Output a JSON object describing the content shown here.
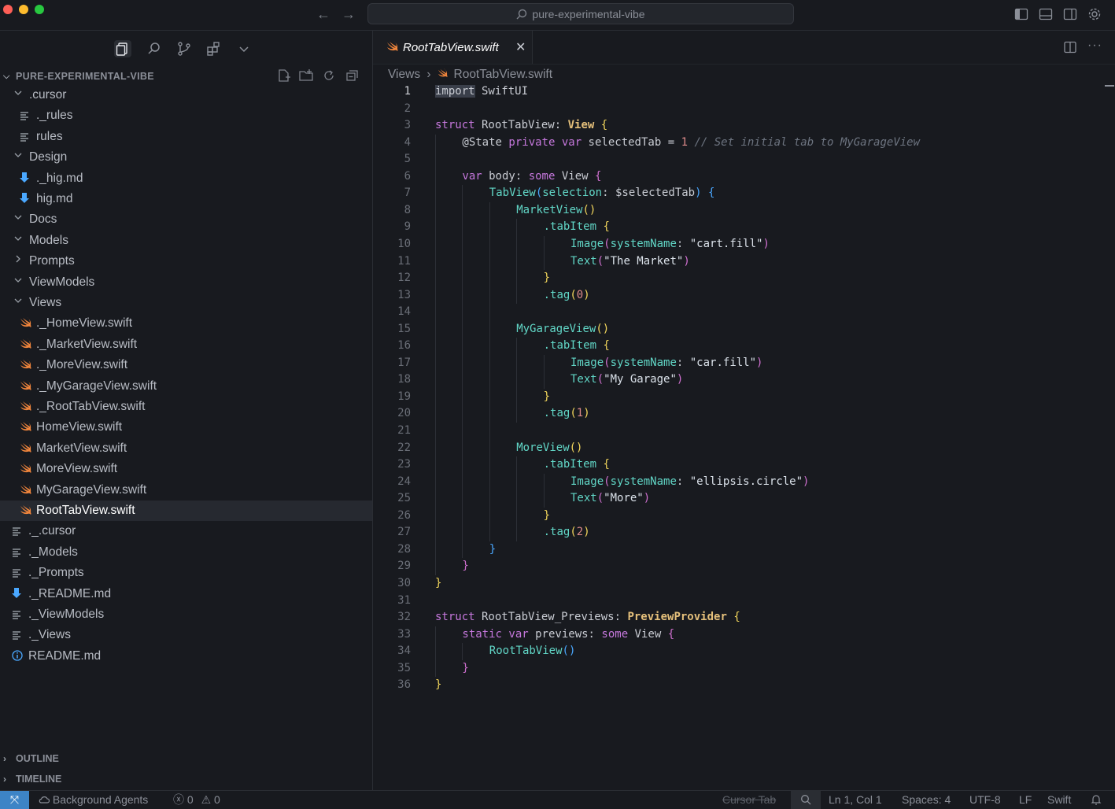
{
  "window": {
    "command_center_text": "pure-experimental-vibe",
    "back_label": "←",
    "forward_label": "→"
  },
  "explorer": {
    "root_label": "PURE-EXPERIMENTAL-VIBE",
    "tree": [
      {
        "label": ".cursor",
        "kind": "folder",
        "expanded": true,
        "depth": 0
      },
      {
        "label": "._rules",
        "kind": "file-lines",
        "depth": 1
      },
      {
        "label": "rules",
        "kind": "file-lines",
        "depth": 1
      },
      {
        "label": "Design",
        "kind": "folder",
        "expanded": true,
        "depth": 0
      },
      {
        "label": "._hig.md",
        "kind": "markdown",
        "depth": 1
      },
      {
        "label": "hig.md",
        "kind": "markdown",
        "depth": 1
      },
      {
        "label": "Docs",
        "kind": "folder",
        "expanded": true,
        "depth": 0
      },
      {
        "label": "Models",
        "kind": "folder",
        "expanded": true,
        "depth": 0
      },
      {
        "label": "Prompts",
        "kind": "folder",
        "expanded": false,
        "depth": 0
      },
      {
        "label": "ViewModels",
        "kind": "folder",
        "expanded": true,
        "depth": 0
      },
      {
        "label": "Views",
        "kind": "folder",
        "expanded": true,
        "depth": 0
      },
      {
        "label": "._HomeView.swift",
        "kind": "swift",
        "depth": 1
      },
      {
        "label": "._MarketView.swift",
        "kind": "swift",
        "depth": 1
      },
      {
        "label": "._MoreView.swift",
        "kind": "swift",
        "depth": 1
      },
      {
        "label": "._MyGarageView.swift",
        "kind": "swift",
        "depth": 1
      },
      {
        "label": "._RootTabView.swift",
        "kind": "swift",
        "depth": 1
      },
      {
        "label": "HomeView.swift",
        "kind": "swift",
        "depth": 1
      },
      {
        "label": "MarketView.swift",
        "kind": "swift",
        "depth": 1
      },
      {
        "label": "MoreView.swift",
        "kind": "swift",
        "depth": 1
      },
      {
        "label": "MyGarageView.swift",
        "kind": "swift",
        "depth": 1
      },
      {
        "label": "RootTabView.swift",
        "kind": "swift",
        "depth": 1,
        "selected": true
      },
      {
        "label": "._.cursor",
        "kind": "file-lines",
        "depth": 0
      },
      {
        "label": "._Models",
        "kind": "file-lines",
        "depth": 0
      },
      {
        "label": "._Prompts",
        "kind": "file-lines",
        "depth": 0
      },
      {
        "label": "._README.md",
        "kind": "markdown",
        "depth": 0
      },
      {
        "label": "._ViewModels",
        "kind": "file-lines",
        "depth": 0
      },
      {
        "label": "._Views",
        "kind": "file-lines",
        "depth": 0
      },
      {
        "label": "README.md",
        "kind": "info",
        "depth": 0
      }
    ],
    "outline_label": "OUTLINE",
    "timeline_label": "TIMELINE"
  },
  "editor": {
    "tab_label": "RootTabView.swift",
    "breadcrumb_folder": "Views",
    "breadcrumb_file": "RootTabView.swift",
    "lines": [
      {
        "indent": 0,
        "tokens": [
          [
            "sel",
            "import"
          ],
          [
            "plain",
            " SwiftUI"
          ]
        ]
      },
      {
        "indent": 0,
        "tokens": []
      },
      {
        "indent": 0,
        "tokens": [
          [
            "kw",
            "struct"
          ],
          [
            "plain",
            " RootTabView: "
          ],
          [
            "ty",
            "View"
          ],
          [
            "plain",
            " "
          ],
          [
            "br1",
            "{"
          ]
        ]
      },
      {
        "indent": 1,
        "tokens": [
          [
            "plain",
            "@State "
          ],
          [
            "kw",
            "private var"
          ],
          [
            "plain",
            " selectedTab = "
          ],
          [
            "num",
            "1"
          ],
          [
            "plain",
            " "
          ],
          [
            "cm",
            "// Set initial tab to MyGarageView"
          ]
        ]
      },
      {
        "indent": 0,
        "tokens": []
      },
      {
        "indent": 1,
        "tokens": [
          [
            "kw",
            "var"
          ],
          [
            "plain",
            " body: "
          ],
          [
            "kw",
            "some"
          ],
          [
            "plain",
            " View "
          ],
          [
            "br2",
            "{"
          ]
        ]
      },
      {
        "indent": 2,
        "tokens": [
          [
            "fn",
            "TabView"
          ],
          [
            "br3",
            "("
          ],
          [
            "fn",
            "selection"
          ],
          [
            "plain",
            ": $selectedTab"
          ],
          [
            "br3",
            ")"
          ],
          [
            "plain",
            " "
          ],
          [
            "br3",
            "{"
          ]
        ]
      },
      {
        "indent": 3,
        "tokens": [
          [
            "fn",
            "MarketView"
          ],
          [
            "br1",
            "()"
          ]
        ]
      },
      {
        "indent": 4,
        "tokens": [
          [
            "fn",
            ".tabItem"
          ],
          [
            "plain",
            " "
          ],
          [
            "br1",
            "{"
          ]
        ]
      },
      {
        "indent": 5,
        "tokens": [
          [
            "fn",
            "Image"
          ],
          [
            "br2",
            "("
          ],
          [
            "fn",
            "systemName"
          ],
          [
            "plain",
            ": "
          ],
          [
            "str",
            "\"cart.fill\""
          ],
          [
            "br2",
            ")"
          ]
        ]
      },
      {
        "indent": 5,
        "tokens": [
          [
            "fn",
            "Text"
          ],
          [
            "br2",
            "("
          ],
          [
            "str",
            "\"The Market\""
          ],
          [
            "br2",
            ")"
          ]
        ]
      },
      {
        "indent": 4,
        "tokens": [
          [
            "br1",
            "}"
          ]
        ]
      },
      {
        "indent": 4,
        "tokens": [
          [
            "fn",
            ".tag"
          ],
          [
            "br1",
            "("
          ],
          [
            "num",
            "0"
          ],
          [
            "br1",
            ")"
          ]
        ]
      },
      {
        "indent": 0,
        "tokens": []
      },
      {
        "indent": 3,
        "tokens": [
          [
            "fn",
            "MyGarageView"
          ],
          [
            "br1",
            "()"
          ]
        ]
      },
      {
        "indent": 4,
        "tokens": [
          [
            "fn",
            ".tabItem"
          ],
          [
            "plain",
            " "
          ],
          [
            "br1",
            "{"
          ]
        ]
      },
      {
        "indent": 5,
        "tokens": [
          [
            "fn",
            "Image"
          ],
          [
            "br2",
            "("
          ],
          [
            "fn",
            "systemName"
          ],
          [
            "plain",
            ": "
          ],
          [
            "str",
            "\"car.fill\""
          ],
          [
            "br2",
            ")"
          ]
        ]
      },
      {
        "indent": 5,
        "tokens": [
          [
            "fn",
            "Text"
          ],
          [
            "br2",
            "("
          ],
          [
            "str",
            "\"My Garage\""
          ],
          [
            "br2",
            ")"
          ]
        ]
      },
      {
        "indent": 4,
        "tokens": [
          [
            "br1",
            "}"
          ]
        ]
      },
      {
        "indent": 4,
        "tokens": [
          [
            "fn",
            ".tag"
          ],
          [
            "br1",
            "("
          ],
          [
            "num",
            "1"
          ],
          [
            "br1",
            ")"
          ]
        ]
      },
      {
        "indent": 0,
        "tokens": []
      },
      {
        "indent": 3,
        "tokens": [
          [
            "fn",
            "MoreView"
          ],
          [
            "br1",
            "()"
          ]
        ]
      },
      {
        "indent": 4,
        "tokens": [
          [
            "fn",
            ".tabItem"
          ],
          [
            "plain",
            " "
          ],
          [
            "br1",
            "{"
          ]
        ]
      },
      {
        "indent": 5,
        "tokens": [
          [
            "fn",
            "Image"
          ],
          [
            "br2",
            "("
          ],
          [
            "fn",
            "systemName"
          ],
          [
            "plain",
            ": "
          ],
          [
            "str",
            "\"ellipsis.circle\""
          ],
          [
            "br2",
            ")"
          ]
        ]
      },
      {
        "indent": 5,
        "tokens": [
          [
            "fn",
            "Text"
          ],
          [
            "br2",
            "("
          ],
          [
            "str",
            "\"More\""
          ],
          [
            "br2",
            ")"
          ]
        ]
      },
      {
        "indent": 4,
        "tokens": [
          [
            "br1",
            "}"
          ]
        ]
      },
      {
        "indent": 4,
        "tokens": [
          [
            "fn",
            ".tag"
          ],
          [
            "br1",
            "("
          ],
          [
            "num",
            "2"
          ],
          [
            "br1",
            ")"
          ]
        ]
      },
      {
        "indent": 2,
        "tokens": [
          [
            "br3",
            "}"
          ]
        ]
      },
      {
        "indent": 1,
        "tokens": [
          [
            "br2",
            "}"
          ]
        ]
      },
      {
        "indent": 0,
        "tokens": [
          [
            "br1",
            "}"
          ]
        ]
      },
      {
        "indent": 0,
        "tokens": []
      },
      {
        "indent": 0,
        "tokens": [
          [
            "kw",
            "struct"
          ],
          [
            "plain",
            " RootTabView_Previews: "
          ],
          [
            "ty",
            "PreviewProvider"
          ],
          [
            "plain",
            " "
          ],
          [
            "br1",
            "{"
          ]
        ]
      },
      {
        "indent": 1,
        "tokens": [
          [
            "kw",
            "static var"
          ],
          [
            "plain",
            " previews: "
          ],
          [
            "kw",
            "some"
          ],
          [
            "plain",
            " View "
          ],
          [
            "br2",
            "{"
          ]
        ]
      },
      {
        "indent": 2,
        "tokens": [
          [
            "fn",
            "RootTabView"
          ],
          [
            "br3",
            "()"
          ]
        ]
      },
      {
        "indent": 1,
        "tokens": [
          [
            "br2",
            "}"
          ]
        ]
      },
      {
        "indent": 0,
        "tokens": [
          [
            "br1",
            "}"
          ]
        ]
      }
    ]
  },
  "statusbar": {
    "remote_icon": "⤧",
    "background_agents": "Background Agents",
    "errors": "0",
    "warnings": "0",
    "cursor_tab": "Cursor Tab",
    "position": "Ln 1, Col 1",
    "spaces": "Spaces: 4",
    "encoding": "UTF-8",
    "eol": "LF",
    "language": "Swift"
  },
  "colors": {
    "accent": "#3d84c6",
    "swift_icon": "#f0853c",
    "markdown_icon": "#4aa8ff"
  }
}
